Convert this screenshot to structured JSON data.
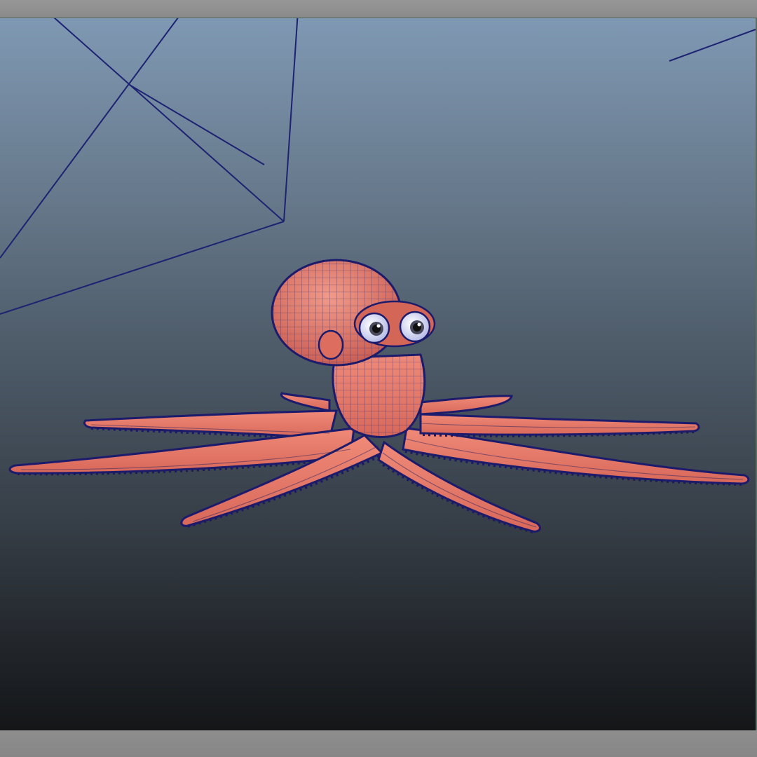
{
  "viewport": {
    "label": "",
    "colors": {
      "background_top": "#7f98b3",
      "background_bottom": "#141618",
      "wireframe": "#1d1b6b",
      "mesh_surface": "#e07766",
      "eye_white": "#f3f3ff",
      "eye_pupil": "#1a1a1a"
    },
    "model": {
      "name": "octopus",
      "display_mode": "wireframe-on-shaded"
    }
  }
}
